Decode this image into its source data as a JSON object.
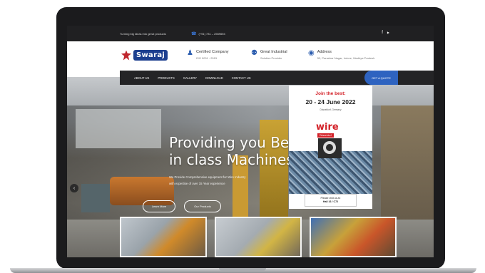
{
  "topbar": {
    "tagline": "Turning big ideas into great products",
    "phone": "(+91) 731 – 2559694",
    "social_facebook": "f",
    "social_youtube": "▶"
  },
  "header": {
    "logo_text": "Swaraj",
    "info": [
      {
        "icon": "person-icon",
        "title": "Certified Company",
        "sub": "ISO 9001 : 2015"
      },
      {
        "icon": "trophy-icon",
        "title": "Great Industrial",
        "sub": "Solution Provider"
      },
      {
        "icon": "globe-icon",
        "title": "Address",
        "sub": "53, Parashar Nagar, Indore, Madhya Pradesh"
      }
    ]
  },
  "nav": {
    "items": [
      "ABOUT US",
      "PRODUCTS",
      "GALLERY",
      "DOWNLOAD",
      "CONTACT US"
    ],
    "quote_button": "GET A QUOTE"
  },
  "hero": {
    "title_line1": "Providing you Be",
    "title_line2": "in class Machines",
    "subtitle_line1": "We Provide Comprehensive equipment for Wire Industry",
    "subtitle_line2": "with expertise of over 15 Year experience",
    "learn_more": "Learn More",
    "our_products": "Our Products",
    "prev_arrow": "‹"
  },
  "promo": {
    "pre": "Join the best:",
    "date": "20 - 24 June 2022",
    "location": "Düsseldorf, Germany",
    "brand": "wire",
    "city": "Düsseldorf",
    "visit_line1": "Please visit us at:",
    "visit_line2": "Hall 16 / C72"
  },
  "colors": {
    "accent_blue": "#2e63c0",
    "brand_red": "#d32128",
    "dark_bar": "#202022"
  }
}
